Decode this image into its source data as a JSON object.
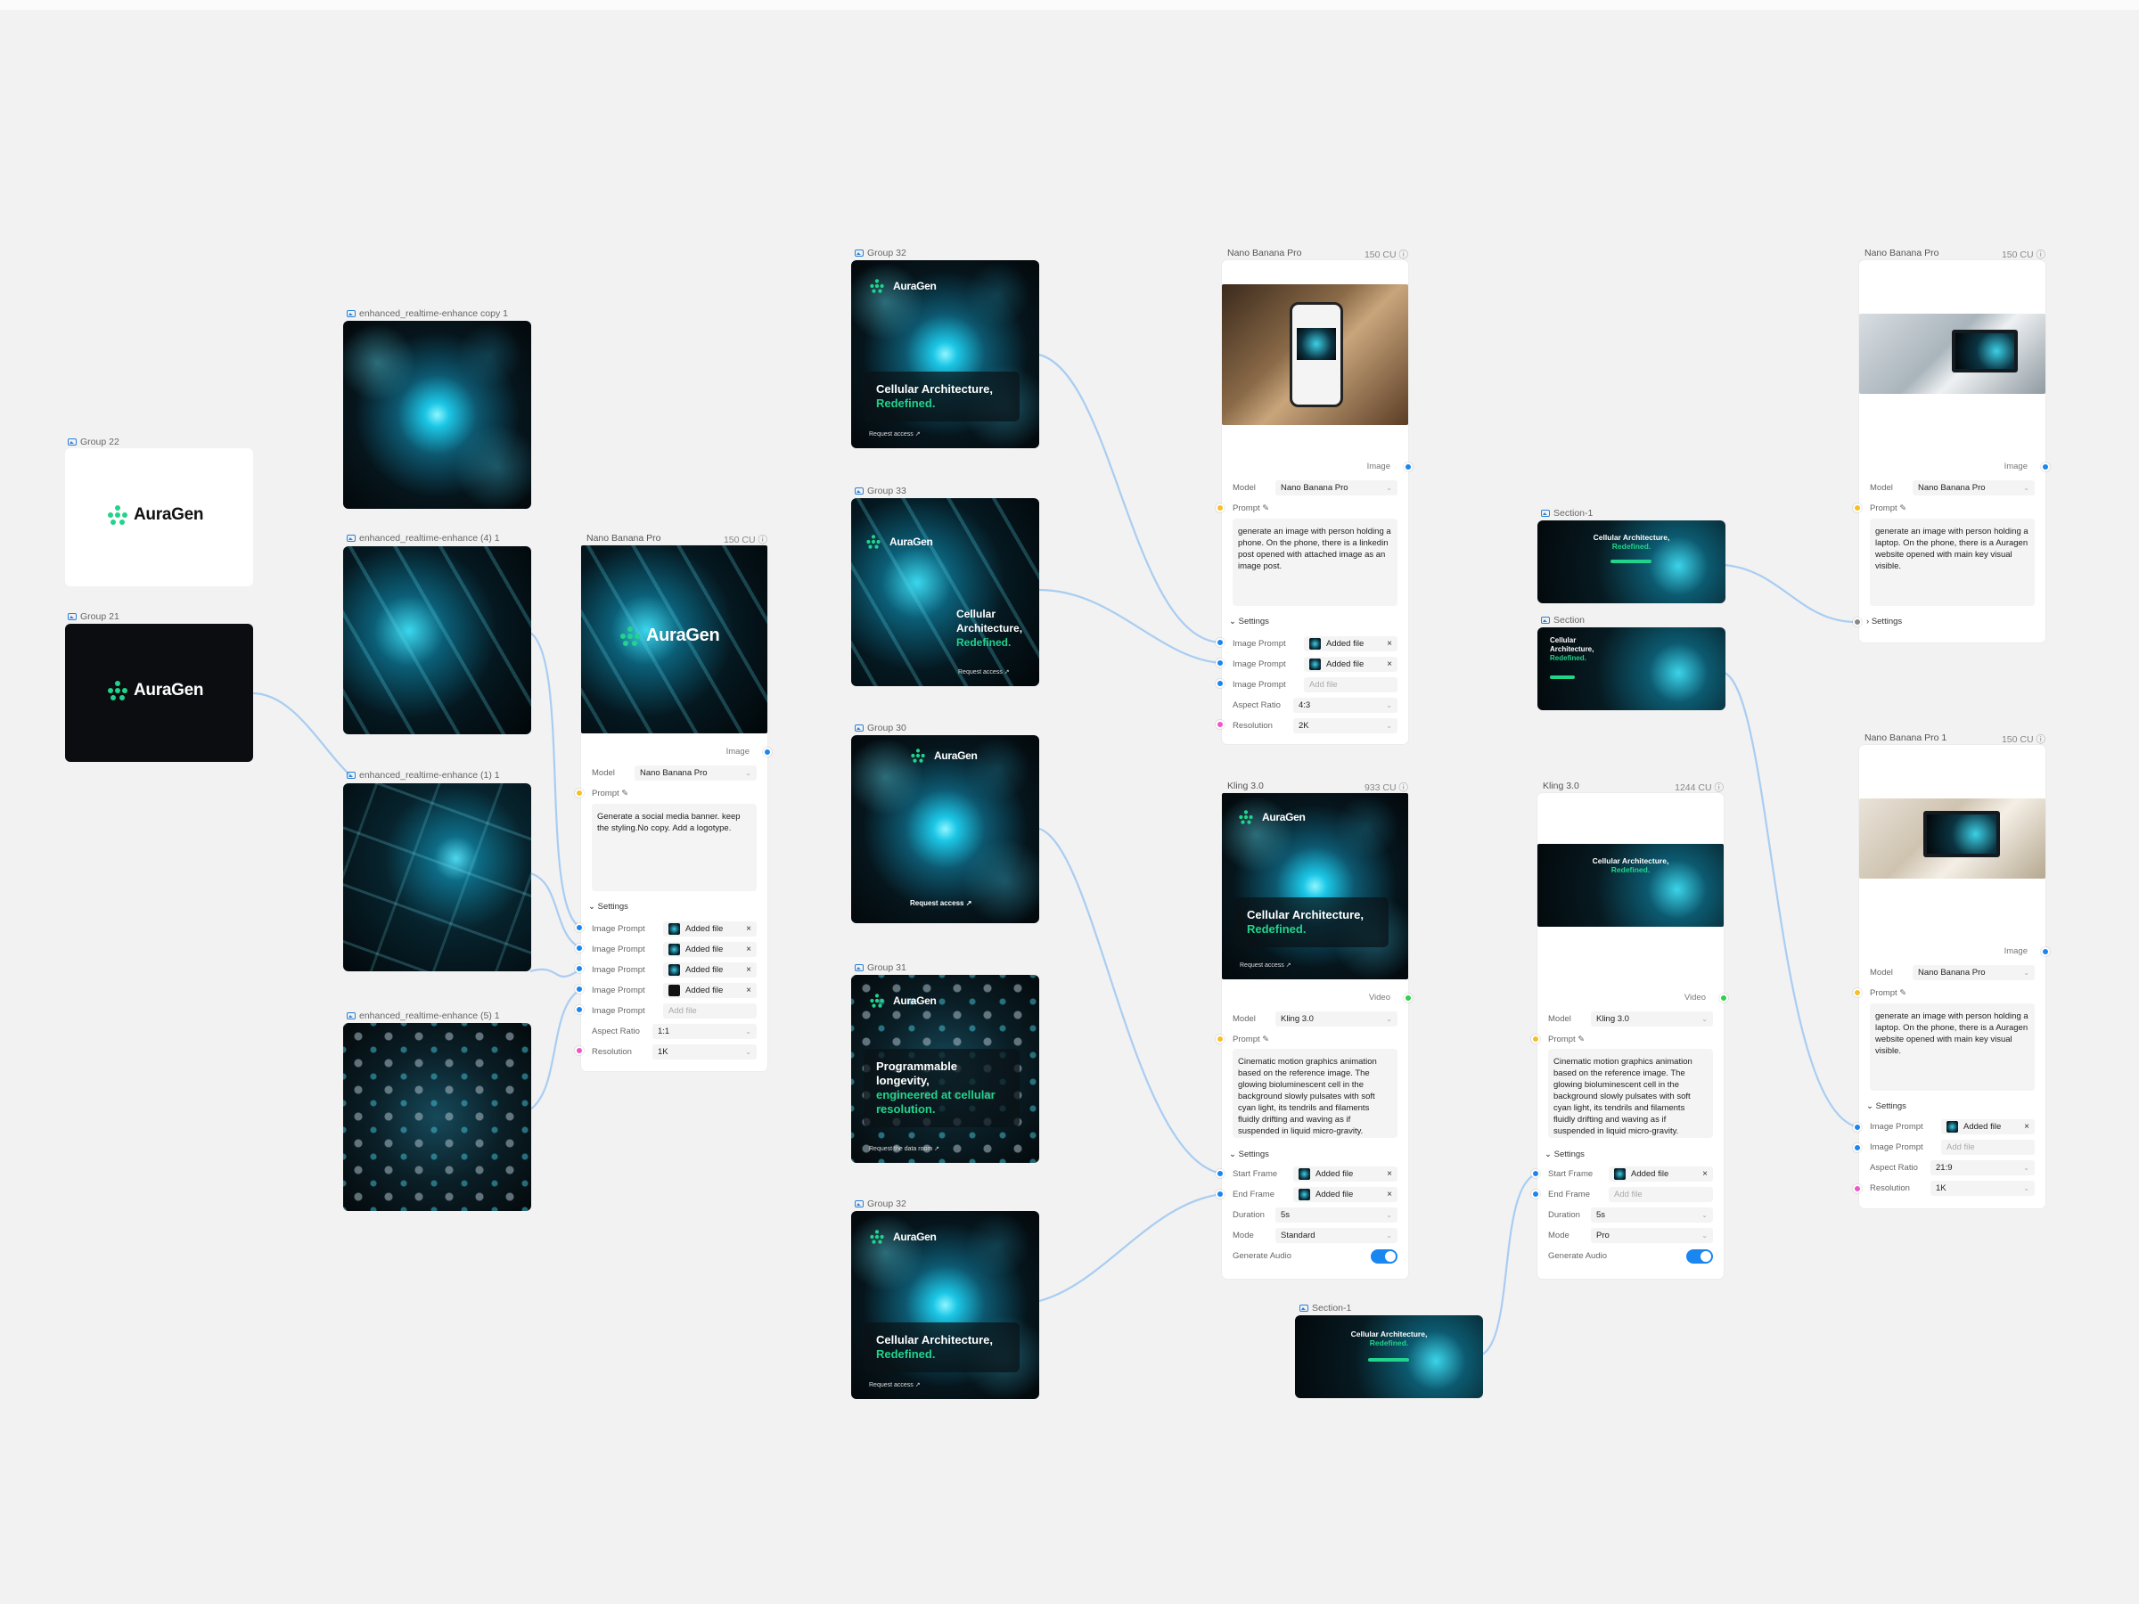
{
  "colors": {
    "canvas_bg": "#f2f2f2",
    "accent_blue": "#1a86f0",
    "brand_green": "#22d38b",
    "port_yellow": "#f5c022",
    "port_pink": "#ee55c9",
    "port_green": "#2fd04a"
  },
  "groups": {
    "g22": "Group 22",
    "g21": "Group 21",
    "enh_copy1": "enhanced_realtime-enhance copy 1",
    "enh4": "enhanced_realtime-enhance (4) 1",
    "enh1": "enhanced_realtime-enhance (1) 1",
    "enh5": "enhanced_realtime-enhance (5) 1",
    "g32a": "Group 32",
    "g33": "Group 33",
    "g30": "Group 30",
    "g31": "Group 31",
    "g32b": "Group 32",
    "section1a": "Section-1",
    "section": "Section",
    "section1b": "Section-1"
  },
  "brand": "AuraGen",
  "ads": {
    "cellular_white": "Cellular Architecture,",
    "cellular_green": "Redefined.",
    "cellular_stack_1": "Cellular",
    "cellular_stack_2": "Architecture,",
    "cellular_stack_3": "Redefined.",
    "request_access": "Request access  ↗",
    "longevity_white": "Programmable longevity,",
    "longevity_green": "engineered at cellular resolution.",
    "request_data_room": "Request the data room  ↗"
  },
  "common": {
    "image": "Image",
    "video": "Video",
    "model": "Model",
    "prompt": "Prompt",
    "settings": "Settings",
    "image_prompt": "Image Prompt",
    "aspect_ratio": "Aspect Ratio",
    "resolution": "Resolution",
    "added_file": "Added file",
    "add_file": "Add file",
    "start_frame": "Start Frame",
    "end_frame": "End Frame",
    "duration": "Duration",
    "mode": "Mode",
    "generate_audio": "Generate Audio"
  },
  "node_a": {
    "title": "Nano Banana Pro",
    "cu": "150 CU",
    "model": "Nano Banana Pro",
    "prompt": "Generate a social media banner. keep the styling.No copy. Add a logotype.",
    "aspect": "1:1",
    "resolution": "1K"
  },
  "node_b": {
    "title": "Nano Banana Pro",
    "cu": "150 CU",
    "model": "Nano Banana Pro",
    "prompt": "generate an image with person holding a phone. On the phone, there is a linkedin post opened with attached image as an image post.",
    "aspect": "4:3",
    "resolution": "2K"
  },
  "node_c": {
    "title": "Kling 3.0",
    "cu": "933 CU",
    "model": "Kling 3.0",
    "prompt": "Cinematic motion graphics animation based on the reference image. The glowing bioluminescent cell in the background slowly pulsates with soft cyan light, its tendrils and filaments fluidly drifting and waving as if suspended in liquid micro-gravity.",
    "duration": "5s",
    "mode": "Standard"
  },
  "node_d": {
    "title": "Kling 3.0",
    "cu": "1244 CU",
    "model": "Kling 3.0",
    "prompt": "Cinematic motion graphics animation based on the reference image. The glowing bioluminescent cell in the background slowly pulsates with soft cyan light, its tendrils and filaments fluidly drifting and waving as if suspended in liquid micro-gravity.",
    "duration": "5s",
    "mode": "Pro"
  },
  "node_e": {
    "title": "Nano Banana Pro",
    "cu": "150 CU",
    "model": "Nano Banana Pro",
    "prompt": "generate an image with person holding a laptop. On the phone, there is a Auragen website opened with main key visual visible."
  },
  "node_f": {
    "title": "Nano Banana Pro 1",
    "cu": "150 CU",
    "model": "Nano Banana Pro",
    "prompt": "generate an image with person holding a laptop. On the phone, there is a Auragen website opened with main key visual visible.",
    "aspect": "21:9",
    "resolution": "1K"
  }
}
